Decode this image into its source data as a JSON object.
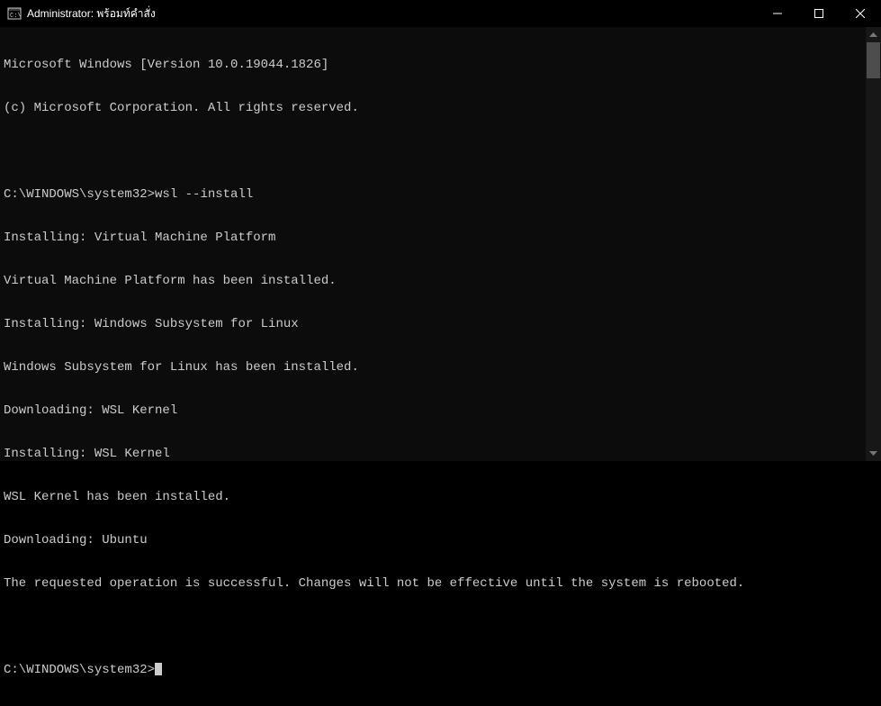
{
  "titleBar": {
    "title": "Administrator: พร้อมท์คำสั่ง"
  },
  "terminal": {
    "header1": "Microsoft Windows [Version 10.0.19044.1826]",
    "header2": "(c) Microsoft Corporation. All rights reserved.",
    "prompt1Path": "C:\\WINDOWS\\system32>",
    "prompt1Cmd": "wsl --install",
    "lines": [
      "Installing: Virtual Machine Platform",
      "Virtual Machine Platform has been installed.",
      "Installing: Windows Subsystem for Linux",
      "Windows Subsystem for Linux has been installed.",
      "Downloading: WSL Kernel",
      "Installing: WSL Kernel",
      "WSL Kernel has been installed.",
      "Downloading: Ubuntu",
      "The requested operation is successful. Changes will not be effective until the system is rebooted."
    ],
    "prompt2Path": "C:\\WINDOWS\\system32>"
  }
}
